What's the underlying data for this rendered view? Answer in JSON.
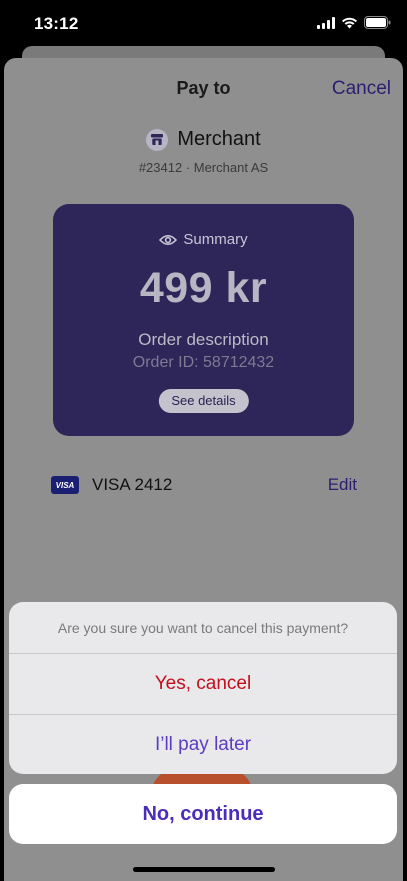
{
  "status_bar": {
    "time": "13:12"
  },
  "header": {
    "title": "Pay to",
    "cancel_label": "Cancel"
  },
  "merchant": {
    "name": "Merchant",
    "subtitle": "#23412 · Merchant AS"
  },
  "summary": {
    "label": "Summary",
    "amount": "499 kr",
    "description": "Order description",
    "order_id": "Order ID: 58712432",
    "details_label": "See details"
  },
  "payment_method": {
    "brand": "VISA",
    "label": "VISA 2412",
    "edit_label": "Edit"
  },
  "dialog": {
    "question": "Are you sure you want to cancel this payment?",
    "destructive_option": "Yes, cancel",
    "later_option": "I’ll pay later",
    "continue_label": "No, continue"
  },
  "colors": {
    "accent": "#4a2dbb",
    "destructive": "#c30f1c",
    "summary_card": "#2e2558"
  }
}
